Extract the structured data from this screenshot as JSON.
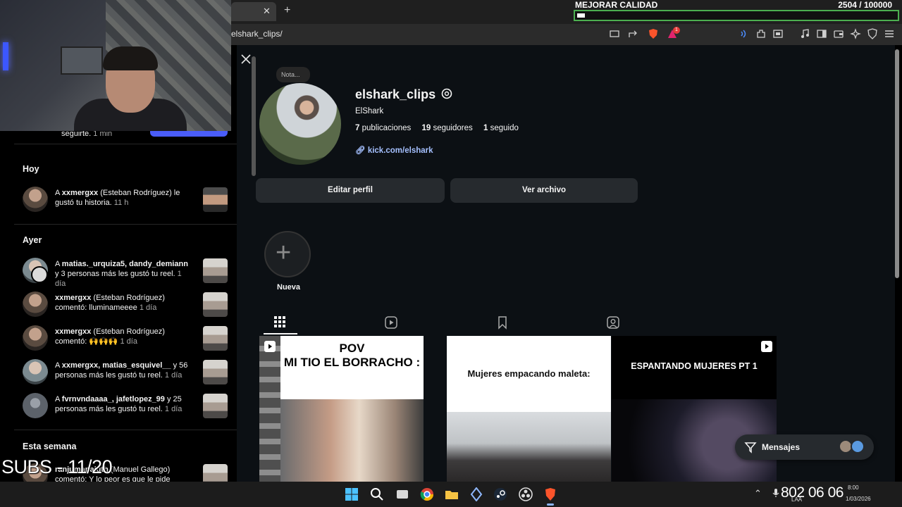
{
  "browser": {
    "url": "elshark_clips/",
    "close_tab": "✕",
    "new_tab": "+",
    "tab_notification_count": "1"
  },
  "overlay": {
    "quality_label": "MEJORAR CALIDAD",
    "quality_count": "2504 / 100000",
    "quality_progress": 0.025,
    "subs_text": "SUBS - 11/20"
  },
  "notifications": {
    "top_partial_text": "seguirte.",
    "top_partial_time": "1 min",
    "sections": {
      "today": "Hoy",
      "yesterday": "Ayer",
      "this_week": "Esta semana"
    },
    "today_items": [
      {
        "prefix": "A ",
        "user": "xxmergxx",
        "rest": " (Esteban Rodríguez) le gustó tu historia.",
        "time": "11 h"
      }
    ],
    "yesterday_items": [
      {
        "prefix": "A ",
        "user": "matias._urquiza5, dandy_demiann",
        "rest": " y 3 personas más les gustó tu reel.",
        "time": "1 día"
      },
      {
        "prefix": "",
        "user": "xxmergxx",
        "rest": " (Esteban Rodríguez) comentó: lluminameeee",
        "time": "1 día"
      },
      {
        "prefix": "",
        "user": "xxmergxx",
        "rest": " (Esteban Rodríguez) comentó: 🙌🙌🙌",
        "time": "1 día"
      },
      {
        "prefix": "A ",
        "user": "xxmergxx, matias_esquivel__",
        "rest": " y 56 personas más les gustó tu reel.",
        "time": "1 día"
      },
      {
        "prefix": "A ",
        "user": "fvrnvndaaaa_, jafetlopez_99",
        "rest": " y 25 personas más les gustó tu reel.",
        "time": "1 día"
      }
    ],
    "week_items": [
      {
        "prefix": "",
        "user": "ranjumanajuth",
        "rest": " (Manuel Gallego) comentó: Y lo peor es que le pide luego",
        "time": ""
      }
    ]
  },
  "profile": {
    "note": "Nota...",
    "username": "elshark_clips",
    "full_name": "ElShark",
    "posts_count": "7",
    "posts_label": "publicaciones",
    "followers_count": "19",
    "followers_label": "seguidores",
    "following_count": "1",
    "following_label": "seguido",
    "link": "kick.com/elshark",
    "edit_button": "Editar perfil",
    "archive_button": "Ver archivo",
    "new_highlight": "Nueva"
  },
  "posts": [
    {
      "title_line1": "POV",
      "title_line2": "MI TIO EL BORRACHO :"
    },
    {
      "title": "Mujeres empacando maleta:"
    },
    {
      "title": "ESPANTANDO MUJERES PT 1"
    }
  ],
  "messages": {
    "label": "Mensajes"
  },
  "taskbar": {
    "tray_big": "802 06 06",
    "time": "8:00",
    "date": "1/03/2026",
    "lang": "LAA"
  },
  "colors": {
    "accent_blue": "#0095f6",
    "link_blue": "#a5c0ff",
    "page_bg": "#0c1014",
    "button_bg": "#262a2e",
    "progress_border": "#4caf50"
  }
}
